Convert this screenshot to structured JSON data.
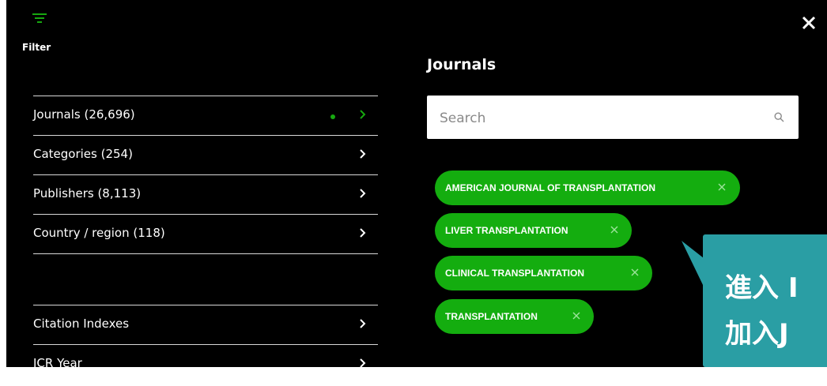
{
  "filter": {
    "label": "Filter",
    "icon": "filter-lines-icon"
  },
  "categories": [
    {
      "label": "Journals (26,696)",
      "has_selection": true
    },
    {
      "label": "Categories (254)",
      "has_selection": false
    },
    {
      "label": "Publishers (8,113)",
      "has_selection": false
    },
    {
      "label": "Country / region (118)",
      "has_selection": false
    }
  ],
  "categories_more": [
    {
      "label": "Citation Indexes"
    },
    {
      "label": "JCR Year"
    }
  ],
  "panel": {
    "title": "Journals",
    "search_placeholder": "Search",
    "search_icon": "search-icon",
    "close_icon": "close-icon"
  },
  "selected_journals": [
    "AMERICAN JOURNAL OF TRANSPLANTATION",
    "LIVER TRANSPLANTATION",
    "CLINICAL TRANSPLANTATION",
    "TRANSPLANTATION"
  ],
  "callout": {
    "line1": "進入 I",
    "line2": "加入J"
  },
  "colors": {
    "panel_bg": "#000000",
    "accent_green": "#17a810",
    "chip_green": "#14ad0f",
    "divider": "#d8d8d8",
    "callout_teal": "#2a9ea4",
    "text_white": "#ffffff"
  }
}
